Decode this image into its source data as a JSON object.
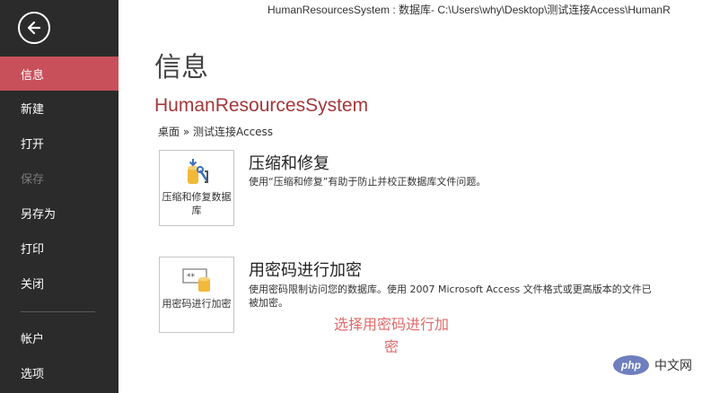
{
  "title_bar": "HumanResourcesSystem : 数据库- C:\\Users\\why\\Desktop\\测试连接Access\\HumanR",
  "sidebar": {
    "items": [
      {
        "label": "信息",
        "state": "active"
      },
      {
        "label": "新建",
        "state": "normal"
      },
      {
        "label": "打开",
        "state": "normal"
      },
      {
        "label": "保存",
        "state": "disabled"
      },
      {
        "label": "另存为",
        "state": "normal"
      },
      {
        "label": "打印",
        "state": "normal"
      },
      {
        "label": "关闭",
        "state": "normal"
      },
      {
        "label": "帐户",
        "state": "normal"
      },
      {
        "label": "选项",
        "state": "normal"
      }
    ]
  },
  "main": {
    "page_title": "信息",
    "db_name": "HumanResourcesSystem",
    "breadcrumb": "桌面 » 测试连接Access",
    "sections": [
      {
        "tile_label": "压缩和修复数据库",
        "heading": "压缩和修复",
        "description": "使用“压缩和修复”有助于防止并校正数据库文件问题。"
      },
      {
        "tile_label": "用密码进行加密",
        "heading": "用密码进行加密",
        "description": "使用密码限制访问您的数据库。使用 2007 Microsoft Access 文件格式或更高版本的文件已被加密。"
      }
    ]
  },
  "annotation": "选择用密码进行加密",
  "watermark": {
    "logo": "php",
    "site": "中文网"
  },
  "colors": {
    "sidebar_bg": "#2b2b2b",
    "active_item": "#c8505a",
    "db_name": "#a4373a",
    "annotation": "#e06a6a"
  }
}
